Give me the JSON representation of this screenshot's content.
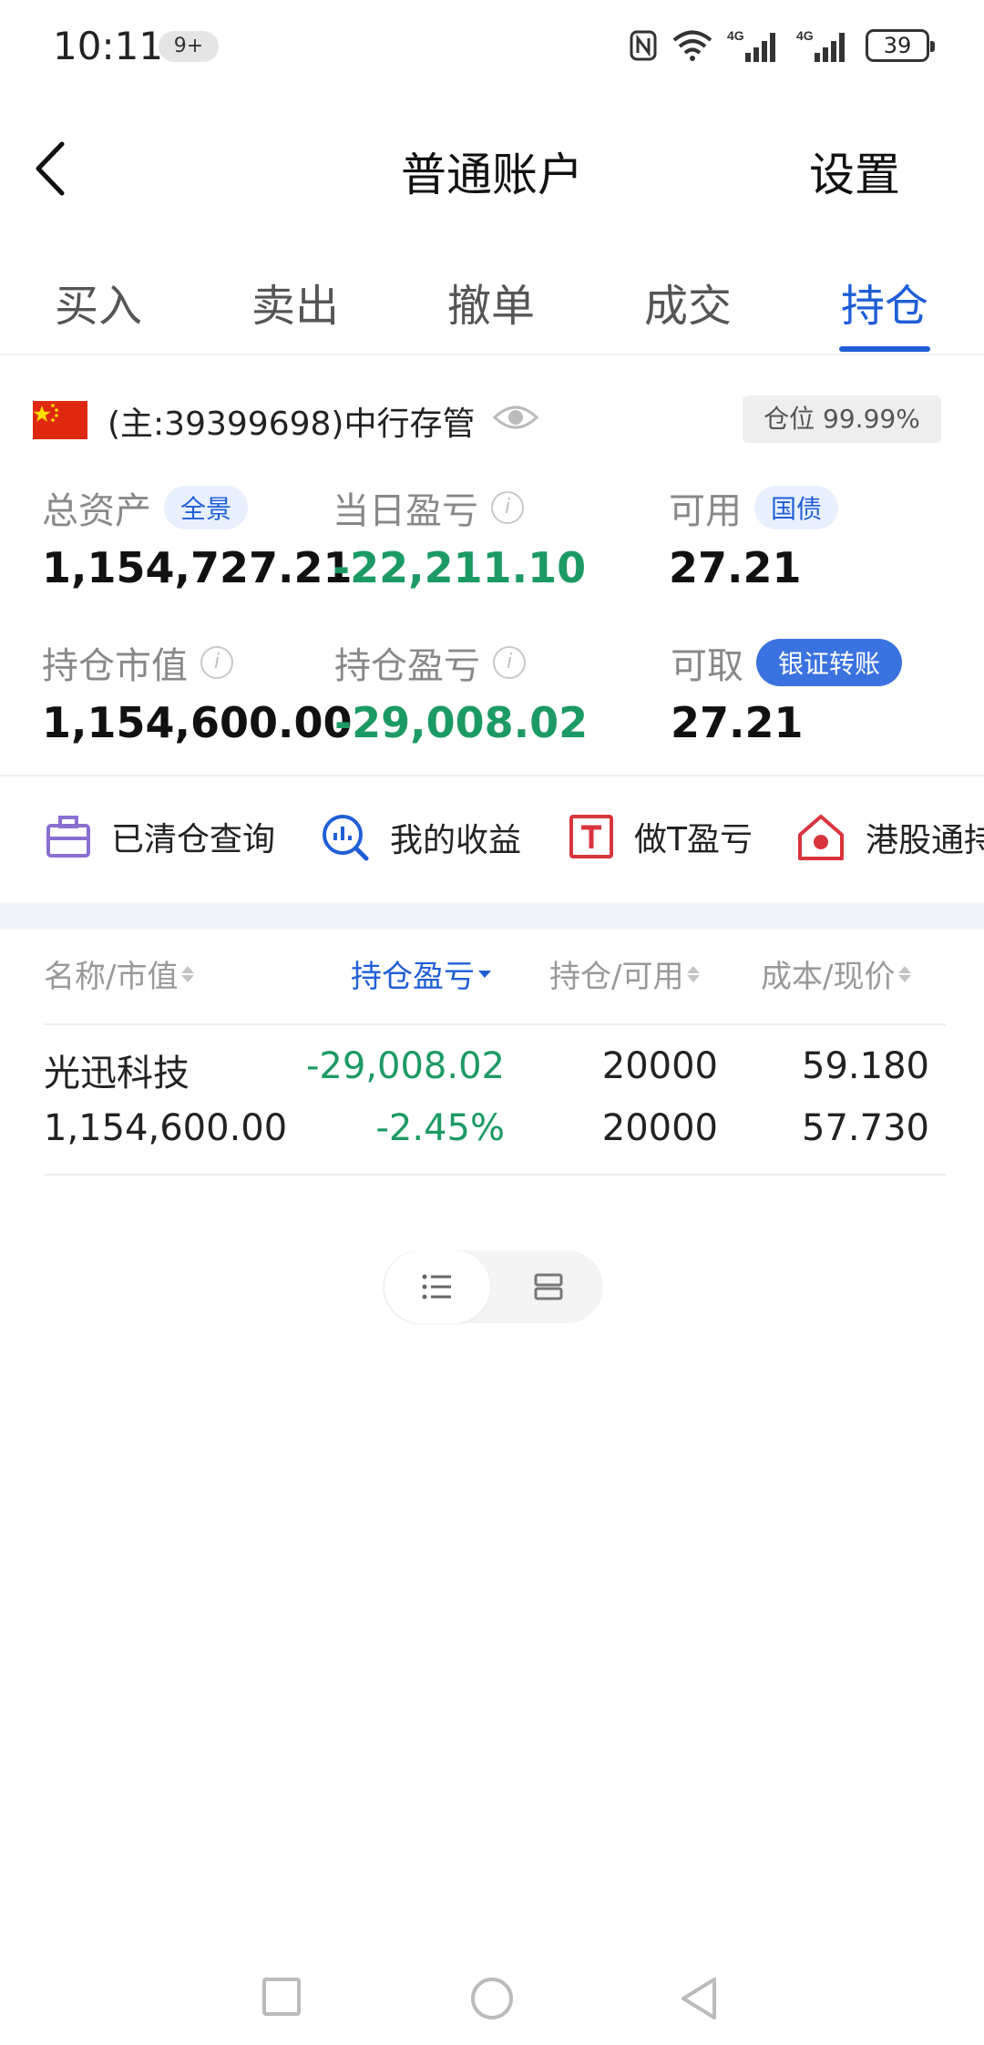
{
  "status_bar": {
    "time": "10:11",
    "notification_badge": "9+",
    "battery": "39",
    "icons": [
      "nfc-icon",
      "wifi-icon",
      "signal-4g-icon",
      "signal-4g-icon",
      "battery-icon"
    ]
  },
  "header": {
    "title": "普通账户",
    "settings_label": "设置"
  },
  "tabs": [
    {
      "label": "买入",
      "active": false
    },
    {
      "label": "卖出",
      "active": false
    },
    {
      "label": "撤单",
      "active": false
    },
    {
      "label": "成交",
      "active": false
    },
    {
      "label": "持仓",
      "active": true
    }
  ],
  "account": {
    "name": "(主:39399698)中行存管",
    "position_ratio": "仓位 99.99%"
  },
  "stats": {
    "total_assets": {
      "label": "总资产",
      "chip": "全景",
      "value": "1,154,727.21"
    },
    "daily_pnl": {
      "label": "当日盈亏",
      "value": "-22,211.10"
    },
    "available": {
      "label": "可用",
      "chip": "国债",
      "value": "27.21"
    },
    "market_value": {
      "label": "持仓市值",
      "value": "1,154,600.00"
    },
    "position_pnl": {
      "label": "持仓盈亏",
      "value": "-29,008.02"
    },
    "withdrawable": {
      "label": "可取",
      "chip": "银证转账",
      "value": "27.21"
    }
  },
  "quick_links": [
    {
      "label": "已清仓查询",
      "icon": "briefcase-icon"
    },
    {
      "label": "我的收益",
      "icon": "chart-search-icon"
    },
    {
      "label": "做T盈亏",
      "icon": "t-box-icon"
    },
    {
      "label": "港股通持",
      "icon": "hk-house-icon"
    }
  ],
  "table": {
    "headers": [
      "名称/市值",
      "持仓盈亏",
      "持仓/可用",
      "成本/现价"
    ],
    "rows": [
      {
        "name": "光迅科技",
        "market_value": "1,154,600.00",
        "pnl": "-29,008.02",
        "pnl_pct": "-2.45%",
        "holding": "20000",
        "available": "20000",
        "cost": "59.180",
        "price": "57.730"
      }
    ]
  },
  "colors": {
    "accent": "#1f5ed6",
    "loss_green": "#1c9a63",
    "flag_red": "#de2910"
  }
}
